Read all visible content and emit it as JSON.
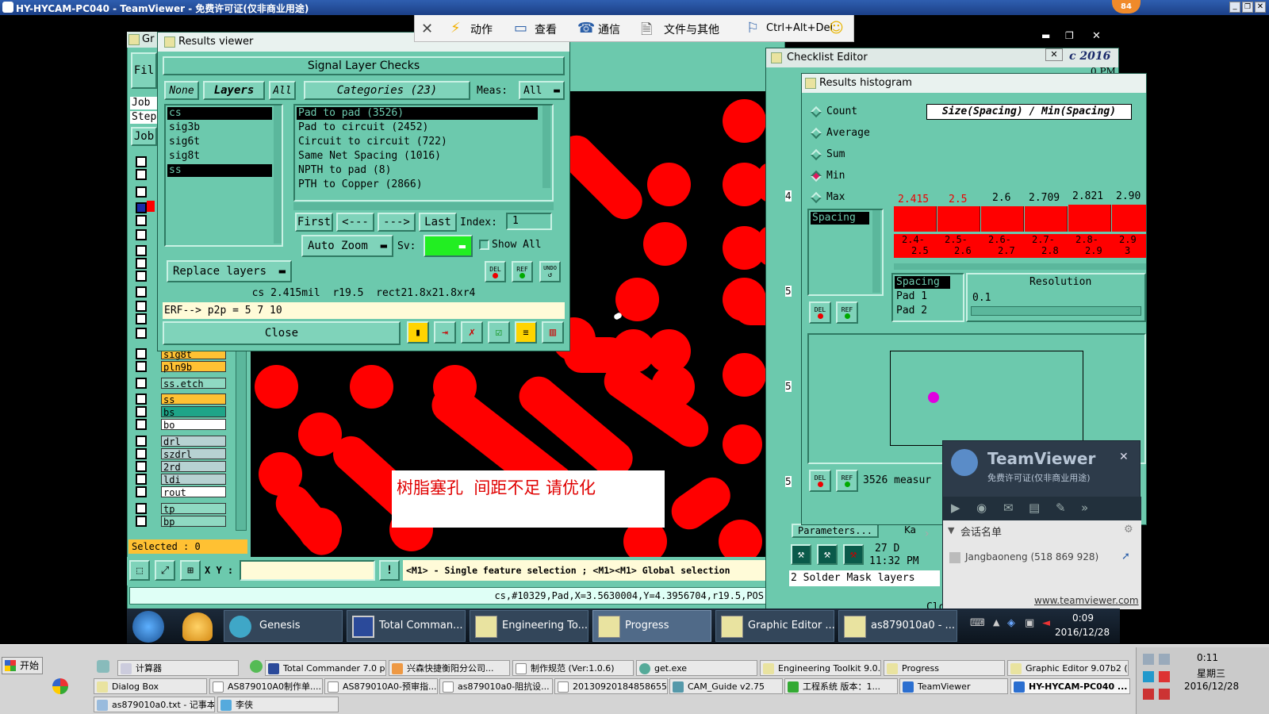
{
  "tv_window": {
    "title": "HY-HYCAM-PC040 - TeamViewer - 免费许可证(仅非商业用途)",
    "badge": "84",
    "toolbar": {
      "actions": "动作",
      "view": "查看",
      "comms": "通信",
      "files": "文件与其他",
      "cad": "Ctrl+Alt+Del"
    }
  },
  "remote": {
    "genesis_partial_title": "Gr",
    "file_menu": "Fil",
    "job_label": "Job",
    "step_label": "Step",
    "job_btn": "Job",
    "layers": [
      {
        "name": "sig8t",
        "color": "#ffc133"
      },
      {
        "name": "pln9b",
        "color": "#ffc133"
      },
      {
        "name": "ss.etch",
        "color": "#8fd9c2"
      },
      {
        "name": "ss",
        "color": "#ffc133"
      },
      {
        "name": "bs",
        "color": "#1ea488"
      },
      {
        "name": "bo",
        "color": "#ffffff"
      },
      {
        "name": "drl",
        "color": "#b7d2d2"
      },
      {
        "name": "szdrl",
        "color": "#b7d2d2"
      },
      {
        "name": "2rd",
        "color": "#b7d2d2"
      },
      {
        "name": "ldi",
        "color": "#b7d2d2"
      },
      {
        "name": "rout",
        "color": "#ffffff"
      },
      {
        "name": "tp",
        "color": "#8fd9c2"
      },
      {
        "name": "bp",
        "color": "#8fd9c2"
      }
    ],
    "selected": "Selected : 0",
    "xy_label": "X Y :",
    "hint": "<M1> - Single feature selection ; <M1><M1> Global selection",
    "status": "cs,#10329,Pad,X=3.5630004,Y=4.3956704,r19.5,POS",
    "annotation": "树脂塞孔  间距不足 请优化",
    "results_viewer": {
      "title": "Results viewer",
      "header": "Signal Layer Checks",
      "none": "None",
      "layers_btn": "Layers",
      "all": "All",
      "categories": "Categories (23)",
      "meas_label": "Meas:",
      "meas_value": "All",
      "layer_list": [
        "cs",
        "sig3b",
        "sig6t",
        "sig8t",
        "ss"
      ],
      "category_list": [
        "Pad to pad (3526)",
        "Pad to circuit (2452)",
        "Circuit to circuit (722)",
        "Same Net Spacing (1016)",
        "NPTH to pad (8)",
        "PTH to Copper (2866)"
      ],
      "first": "First",
      "prev": "<---",
      "next": "--->",
      "last": "Last",
      "index_label": "Index:",
      "index_value": "1",
      "auto_zoom": "Auto Zoom",
      "sv": "Sv:",
      "show_all": "Show All",
      "replace_layers": "Replace layers",
      "del": "DEL",
      "ref": "REF",
      "undo": "UNDO",
      "info": "cs 2.415mil  r19.5  rect21.8x21.8xr4",
      "erf": "ERF--> p2p = 5 7 10",
      "close": "Close"
    },
    "checklist": {
      "title": "Checklist Editor",
      "date": "c 2016",
      "ampm": "0 PM",
      "parameters": "Parameters...",
      "ka": "Ka",
      "time1": "27 D",
      "time2": "11:32 PM",
      "solder": "2 Solder Mask layers",
      "clo": "Clo",
      "row_nums": [
        "4",
        "5",
        "5",
        "5"
      ]
    },
    "histogram": {
      "title": "Results histogram",
      "radios": [
        {
          "label": "Count",
          "selected": false
        },
        {
          "label": "Average",
          "selected": false
        },
        {
          "label": "Sum",
          "selected": false
        },
        {
          "label": "Min",
          "selected": true
        },
        {
          "label": "Max",
          "selected": false
        }
      ],
      "measure_label": "Size(Spacing) / Min(Spacing)",
      "list_item": "Spacing",
      "bar_values": [
        "2.415",
        "2.5",
        "2.6",
        "2.709",
        "2.821",
        "2.90"
      ],
      "bins_top": [
        "2.4-",
        "2.5-",
        "2.6-",
        "2.7-",
        "2.8-",
        "2.9"
      ],
      "bins_bot": [
        "2.5",
        "2.6",
        "2.7",
        "2.8",
        "2.9",
        "3"
      ],
      "spacing_list": [
        "Spacing",
        "Pad 1",
        "Pad 2"
      ],
      "resolution_label": "Resolution",
      "resolution_value": "0.1",
      "measures_text": "3526 measur",
      "del": "DEL",
      "ref": "REF"
    },
    "taskbar": {
      "items": [
        "Genesis",
        "Total Comman...",
        "Engineering To...",
        "Progress",
        "Graphic Editor ...",
        "as879010a0 - ..."
      ],
      "time": "0:09",
      "date": "2016/12/28"
    }
  },
  "tv_panel": {
    "brand": "TeamViewer",
    "license": "免费许可证(仅非商业用途)",
    "session_list": "会话名单",
    "contact": "Jangbaoneng (518 869 928)",
    "link": "www.teamviewer.com"
  },
  "local_taskbar": {
    "start": "开始",
    "row1": [
      "计算器",
      "Total Commander 7.0 p...",
      "兴森快捷衡阳分公司...",
      "制作规范 (Ver:1.0.6)",
      "get.exe",
      "Engineering Toolkit 9.0...",
      "Progress",
      "Graphic Editor 9.07b2 (..."
    ],
    "row2": [
      "Dialog Box",
      "AS879010A0制作单....",
      "AS879010A0-预审指...",
      "as879010a0-阻抗设...",
      "20130920184858655...",
      "CAM_Guide v2.75",
      "工程系统  版本：1...",
      "TeamViewer",
      "HY-HYCAM-PC040 ..."
    ],
    "row3": [
      "as879010a0.txt - 记事本",
      "李侠"
    ],
    "time": "0:11",
    "weekday": "星期三",
    "date": "2016/12/28"
  }
}
